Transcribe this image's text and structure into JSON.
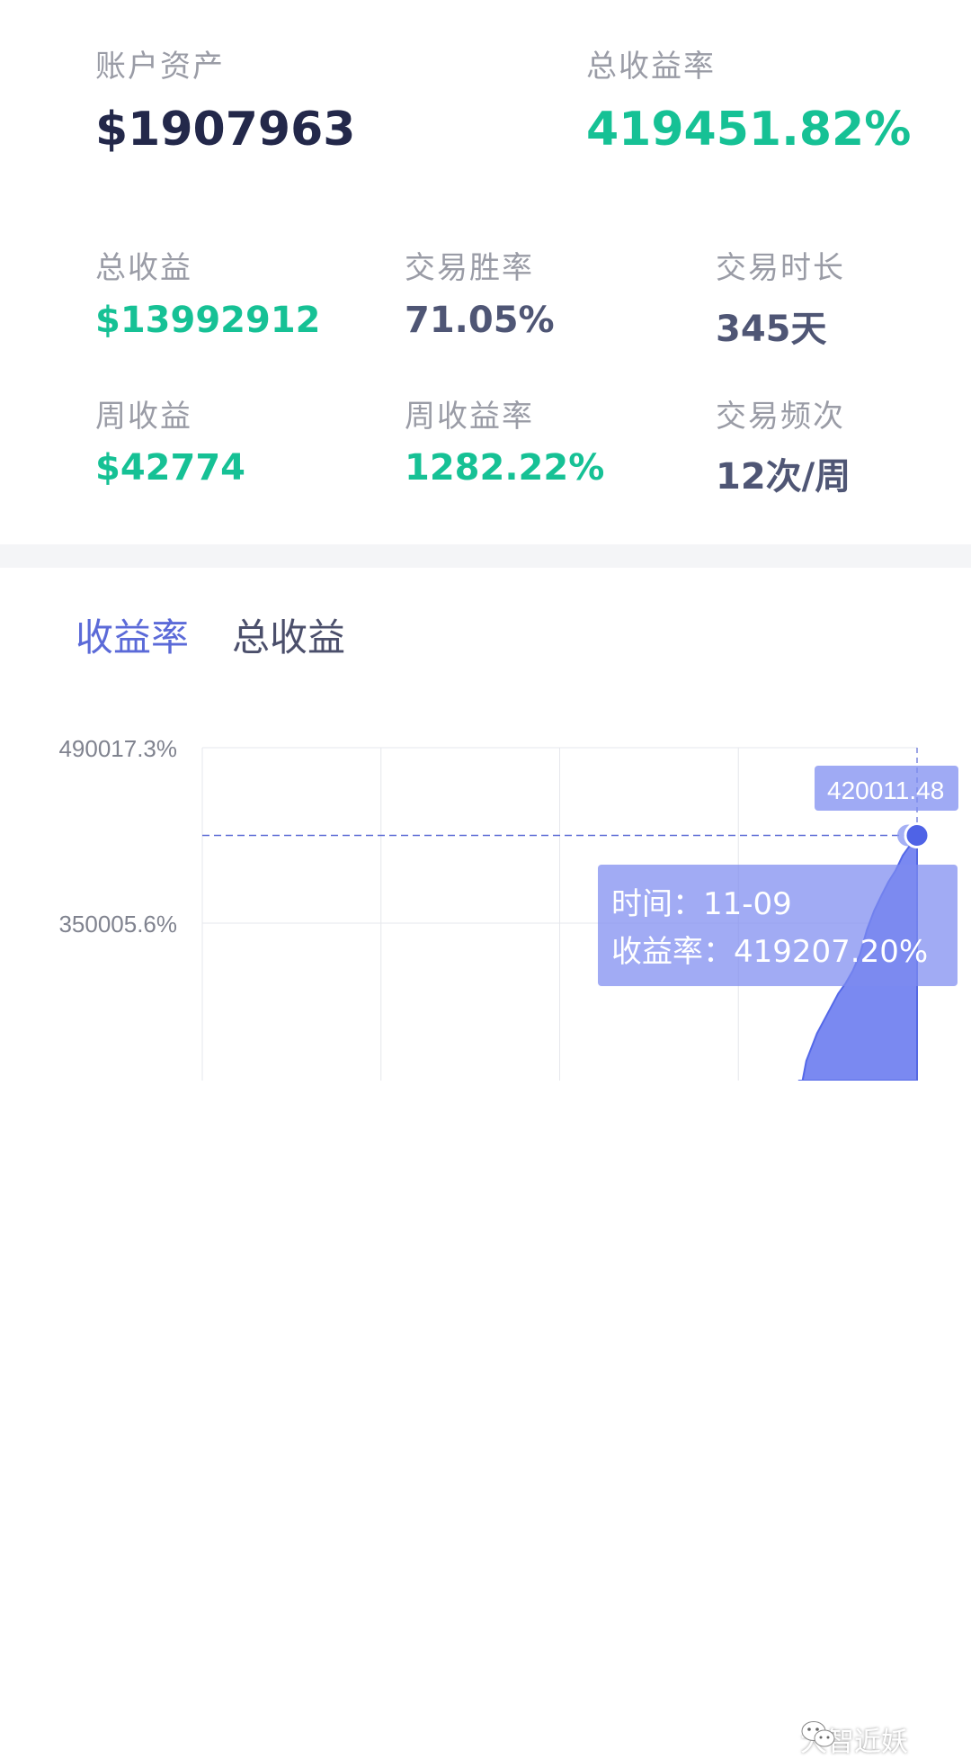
{
  "summary": {
    "account_assets_label": "账户资产",
    "account_assets_value": "$1907963",
    "total_return_rate_label": "总收益率",
    "total_return_rate_value": "419451.82%"
  },
  "stats": [
    {
      "label": "总收益",
      "value": "$13992912",
      "tone": "green"
    },
    {
      "label": "交易胜率",
      "value": "71.05%",
      "tone": "slate"
    },
    {
      "label": "交易时长",
      "value": "345天",
      "tone": "slate"
    },
    {
      "label": "周收益",
      "value": "$42774",
      "tone": "green"
    },
    {
      "label": "周收益率",
      "value": "1282.22%",
      "tone": "green"
    },
    {
      "label": "交易频次",
      "value": "12次/周",
      "tone": "slate"
    }
  ],
  "tabs": {
    "return_rate": "收益率",
    "total_return": "总收益"
  },
  "active_tab": "return_rate",
  "chart_data": {
    "type": "area",
    "y_tick_labels": [
      "490017.3%",
      "350005.6%"
    ],
    "y_ticks": [
      490017.3,
      350005.6
    ],
    "ylim_visible": [
      210000,
      500000
    ],
    "crosshair_value": 420011.48,
    "crosshair_label": "420011.48",
    "tooltip": {
      "time_label": "时间：",
      "time_value": "11-09",
      "rate_label": "收益率：",
      "rate_value": "419207.20%"
    },
    "series_points": [
      [
        0.835,
        210000
      ],
      [
        0.845,
        240000
      ],
      [
        0.86,
        262000
      ],
      [
        0.875,
        278000
      ],
      [
        0.89,
        294000
      ],
      [
        0.9,
        302000
      ],
      [
        0.91,
        312000
      ],
      [
        0.92,
        325000
      ],
      [
        0.93,
        345000
      ],
      [
        0.94,
        360000
      ],
      [
        0.95,
        372000
      ],
      [
        0.96,
        383000
      ],
      [
        0.97,
        392000
      ],
      [
        0.98,
        404000
      ],
      [
        0.99,
        412000
      ],
      [
        1.0,
        420011.48
      ]
    ],
    "colors": {
      "fill": "#6b7cf0",
      "line": "#5468e8",
      "grid": "#e6e7ec"
    }
  },
  "watermark": "大智近妖"
}
